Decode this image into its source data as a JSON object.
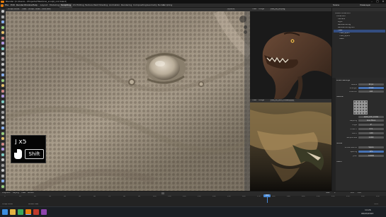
{
  "titlebar": {
    "title": "Blender [C:\\Users\\...\\Projects\\TRex\\trex_sculpt_v12.blend]",
    "min": "–",
    "max": "□",
    "close": "✕"
  },
  "menubar": {
    "menus": [
      "File",
      "Edit",
      "Render",
      "Window",
      "Help"
    ],
    "tabs": [
      "Layout",
      "Modeling",
      "Sculpting",
      "UV Editing",
      "Texture Paint",
      "Shading",
      "Animation",
      "Rendering",
      "Compositing",
      "Geometry Nodes",
      "Scripting"
    ],
    "active_tab": "Sculpting",
    "scene_label": "Scene",
    "viewlayer_label": "ViewLayer"
  },
  "viewport_header": {
    "mode": "Sculpt Mode",
    "view": "View",
    "sculpt": "Sculpt",
    "mask": "Mask",
    "face_sets": "Face Sets",
    "options": "Options"
  },
  "ref1_header": {
    "view": "View",
    "image": "Image",
    "name": "trex_ref_01.png"
  },
  "ref2_header": {
    "view": "View",
    "image": "Image",
    "name": "trex_ref_skin_closeup.jpg"
  },
  "outliner": {
    "rows": [
      {
        "label": "Scene Collection",
        "selected": false
      },
      {
        "label": "Collection",
        "selected": false
      },
      {
        "label": "Camera",
        "selected": false
      },
      {
        "label": "Light",
        "selected": false
      },
      {
        "label": "ReferenceImg",
        "selected": false
      },
      {
        "label": "ReferenceImg.001",
        "selected": false
      },
      {
        "label": "TRex",
        "selected": true
      },
      {
        "label": "TRex_eye.L",
        "selected": false
      },
      {
        "label": "TRex_eye.R",
        "selected": false
      },
      {
        "label": "Teeth",
        "selected": false
      }
    ]
  },
  "properties": {
    "section_brush": "Brush Settings",
    "radius_label": "Radius",
    "radius_value": "62 px",
    "strength_label": "Strength",
    "strength_value": "0.500",
    "direction_label": "Direction",
    "direction_value": "Add",
    "section_texture": "Texture",
    "texture_name": "alpha_skin_scales",
    "mapping_label": "Mapping",
    "mapping_value": "Area Plane",
    "angle_label": "Angle",
    "angle_value": "0°",
    "offset_label": "Offset X",
    "offset_value": "0 m",
    "size_label": "Size X",
    "size_value": "1.00",
    "sample_bias_label": "Sample Bias",
    "sample_bias_value": "0.000",
    "section_stroke": "Stroke",
    "stroke_method_label": "Stroke Method",
    "stroke_method_value": "Space",
    "spacing_label": "Spacing",
    "spacing_value": "10%",
    "jitter_label": "Jitter",
    "jitter_value": "0.0000",
    "section_falloff": "Falloff"
  },
  "keyoverlay": {
    "count": "] x5",
    "key": "Shift"
  },
  "timeline": {
    "menus": [
      "Playback",
      "Keying",
      "View",
      "Marker"
    ],
    "frames": [
      "0",
      "10",
      "20",
      "30",
      "40",
      "50",
      "60",
      "70",
      "80",
      "90",
      "100",
      "110",
      "120",
      "130",
      "140",
      "150",
      "160",
      "170",
      "180",
      "190",
      "200",
      "210",
      "220",
      "230",
      "240",
      "250"
    ],
    "current_frame": "180",
    "start_label": "Start",
    "start_value": "1",
    "end_label": "End",
    "end_value": "250"
  },
  "status": {
    "left": "Sculpt Mode",
    "middle": "Rotate View",
    "right": "3.6.2"
  },
  "taskbar": {
    "time": "14:26",
    "date": "08/03/2023"
  },
  "colors": {
    "accent": "#4772b3",
    "playhead": "#4a8ad6",
    "selection": "#334d80"
  }
}
